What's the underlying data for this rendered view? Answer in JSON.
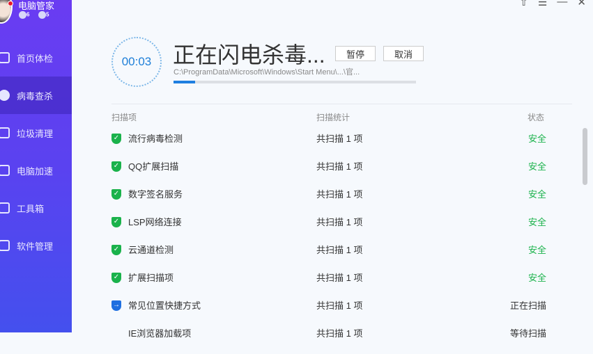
{
  "app": {
    "name": "电脑管家",
    "badges": [
      "6",
      "5"
    ]
  },
  "window_controls": [
    "⇧",
    "☰",
    "—",
    "✕"
  ],
  "sidebar": {
    "items": [
      {
        "label": "首页体检",
        "icon": "monitor-icon"
      },
      {
        "label": "病毒查杀",
        "icon": "lightning-icon",
        "active": true
      },
      {
        "label": "垃圾清理",
        "icon": "broom-icon"
      },
      {
        "label": "电脑加速",
        "icon": "rocket-icon"
      },
      {
        "label": "工具箱",
        "icon": "toolbox-icon"
      },
      {
        "label": "软件管理",
        "icon": "apps-icon"
      }
    ]
  },
  "scan": {
    "timer": "00:03",
    "title": "正在闪电杀毒...",
    "pause": "暂停",
    "cancel": "取消",
    "path": "C:\\ProgramData\\Microsoft\\Windows\\Start Menu\\...\\官...",
    "progress_percent": 9
  },
  "table": {
    "headers": [
      "扫描项",
      "扫描统计",
      "状态"
    ],
    "rows": [
      {
        "name": "流行病毒检测",
        "count": "共扫描 1 项",
        "status": "安全",
        "state": "safe"
      },
      {
        "name": "QQ扩展扫描",
        "count": "共扫描 1 项",
        "status": "安全",
        "state": "safe"
      },
      {
        "name": "数字签名服务",
        "count": "共扫描 1 项",
        "status": "安全",
        "state": "safe"
      },
      {
        "name": "LSP网络连接",
        "count": "共扫描 1 项",
        "status": "安全",
        "state": "safe"
      },
      {
        "name": "云通道检测",
        "count": "共扫描 1 项",
        "status": "安全",
        "state": "safe"
      },
      {
        "name": "扩展扫描项",
        "count": "共扫描 1 项",
        "status": "安全",
        "state": "safe"
      },
      {
        "name": "常见位置快捷方式",
        "count": "共扫描 1 项",
        "status": "正在扫描",
        "state": "scanning"
      },
      {
        "name": "IE浏览器加载项",
        "count": "共扫描 1 项",
        "status": "等待扫描",
        "state": "waiting"
      }
    ]
  },
  "colors": {
    "safe": "#1ab24b",
    "scanning": "#1f6fe0",
    "accent": "#1e7fd8"
  }
}
